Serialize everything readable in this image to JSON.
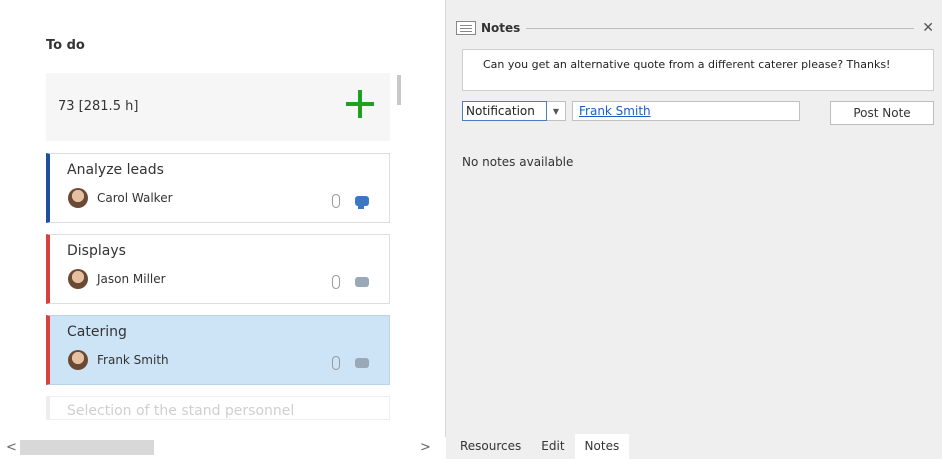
{
  "todo": {
    "title": "To do",
    "summary": "73 [281.5 h]",
    "cards": [
      {
        "title": "Analyze leads",
        "user": "Carol Walker",
        "accent": "#1f4ea3",
        "comment_active": true
      },
      {
        "title": "Displays",
        "user": "Jason Miller",
        "accent": "#d94040",
        "comment_active": false
      },
      {
        "title": "Catering",
        "user": "Frank Smith",
        "accent": "#d94040",
        "comment_active": false,
        "selected": true
      },
      {
        "title": "Selection of the stand personnel",
        "user": "",
        "accent": "#e99999"
      }
    ]
  },
  "notes": {
    "title": "Notes",
    "note_text": "Can you get an alternative quote from a different caterer please? Thanks!",
    "type_value": "Notification",
    "user_value": "Frank Smith",
    "post_label": "Post Note",
    "empty_text": "No notes available"
  },
  "tabs": [
    "Resources",
    "Edit",
    "Notes"
  ]
}
